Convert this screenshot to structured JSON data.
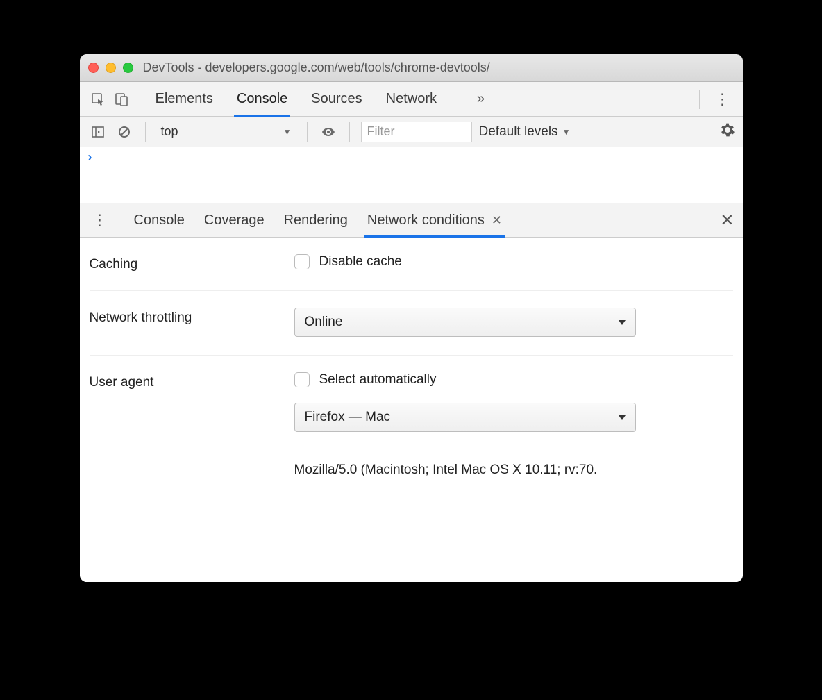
{
  "window": {
    "title": "DevTools - developers.google.com/web/tools/chrome-devtools/"
  },
  "main_tabs": {
    "items": [
      "Elements",
      "Console",
      "Sources",
      "Network"
    ],
    "active": "Console",
    "overflow": "»"
  },
  "console_toolbar": {
    "context": "top",
    "filter_placeholder": "Filter",
    "levels_label": "Default levels"
  },
  "console": {
    "prompt": "›"
  },
  "drawer": {
    "tabs": [
      "Console",
      "Coverage",
      "Rendering",
      "Network conditions"
    ],
    "active": "Network conditions"
  },
  "network_conditions": {
    "caching": {
      "label": "Caching",
      "checkbox_label": "Disable cache"
    },
    "throttling": {
      "label": "Network throttling",
      "value": "Online"
    },
    "user_agent": {
      "label": "User agent",
      "auto_label": "Select automatically",
      "ua_value": "Firefox — Mac",
      "ua_string": "Mozilla/5.0 (Macintosh; Intel Mac OS X 10.11; rv:70."
    }
  }
}
